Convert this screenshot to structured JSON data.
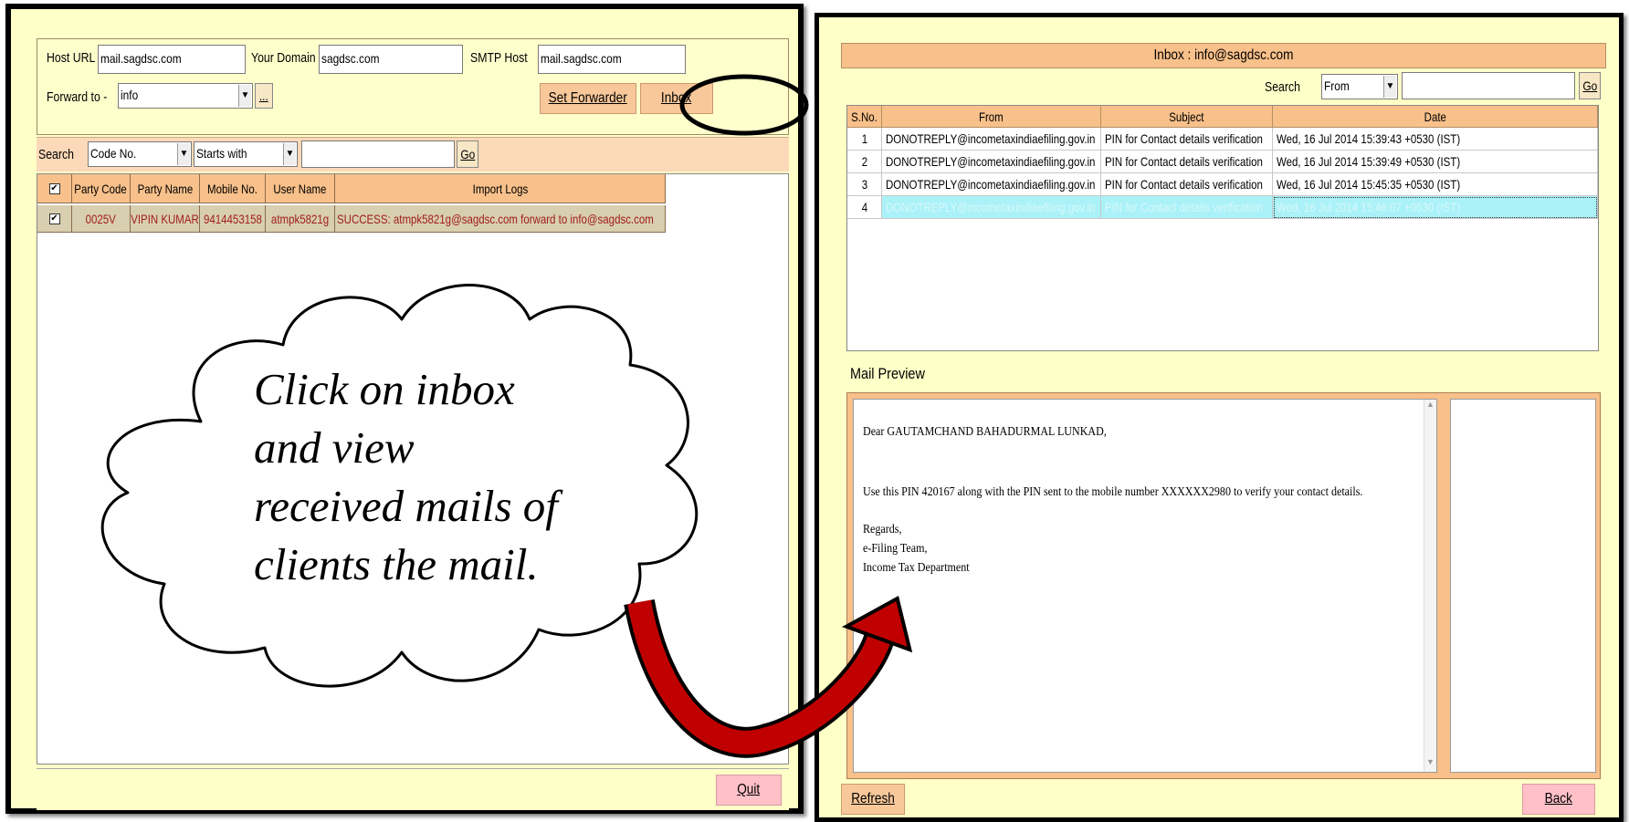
{
  "left_window": {
    "host_url_label": "Host URL",
    "host_url_value": "mail.sagdsc.com",
    "your_domain_label": "Your Domain",
    "your_domain_value": "sagdsc.com",
    "smtp_host_label": "SMTP Host",
    "smtp_host_value": "mail.sagdsc.com",
    "forward_to_label": "Forward to -",
    "forward_to_value": "info",
    "browse_label": "...",
    "set_forwarder_label": "Set Forwarder",
    "inbox_label": "Inbox",
    "search_label": "Search",
    "search_field_value": "Code No.",
    "search_mode_value": "Starts with",
    "search_input_value": "",
    "go_label": "Go",
    "columns": [
      "Party Code",
      "Party Name",
      "Mobile No.",
      "User Name",
      "Import Logs"
    ],
    "rows": [
      {
        "checked": true,
        "party_code": "0025V",
        "party_name": "VIPIN KUMAR",
        "mobile_no": "9414453158",
        "user_name": "atmpk5821g",
        "import_log": "SUCCESS: atmpk5821g@sagdsc.com forward to info@sagdsc.com"
      }
    ],
    "quit_label": "Quit"
  },
  "right_window": {
    "title": "Inbox : info@sagdsc.com",
    "search_label": "Search",
    "search_field_value": "From",
    "search_input_value": "",
    "go_label": "Go",
    "columns": [
      "S.No.",
      "From",
      "Subject",
      "Date"
    ],
    "mails": [
      {
        "sno": "1",
        "from": "DONOTREPLY@incometaxindiaefiling.gov.in",
        "subject": "PIN for Contact details verification",
        "date": "Wed, 16 Jul 2014 15:39:43 +0530 (IST)"
      },
      {
        "sno": "2",
        "from": "DONOTREPLY@incometaxindiaefiling.gov.in",
        "subject": "PIN for Contact details verification",
        "date": "Wed, 16 Jul 2014 15:39:49 +0530 (IST)"
      },
      {
        "sno": "3",
        "from": "DONOTREPLY@incometaxindiaefiling.gov.in",
        "subject": "PIN for Contact details verification",
        "date": "Wed, 16 Jul 2014 15:45:35 +0530 (IST)"
      },
      {
        "sno": "4",
        "from": "DONOTREPLY@incometaxindiaefiling.gov.in",
        "subject": "PIN for Contact details verification",
        "date": "Wed, 16 Jul 2014 15:46:07 +0530 (IST)"
      }
    ],
    "selected_index": 3,
    "preview_label": "Mail Preview",
    "preview": {
      "greeting": "Dear GAUTAMCHAND BAHADURMAL LUNKAD,",
      "body": "Use this PIN 420167 along with the PIN sent to the mobile number XXXXXX2980 to verify your contact details.",
      "closing_1": "Regards,",
      "closing_2": "e-Filing Team,",
      "closing_3": "Income Tax Department"
    },
    "refresh_label": "Refresh",
    "back_label": "Back"
  },
  "annotation": {
    "line_1": "Click on inbox",
    "line_2": "and view",
    "line_3": "received mails of",
    "line_4": "clients the mail.",
    "arrow_color": "#c00000"
  }
}
